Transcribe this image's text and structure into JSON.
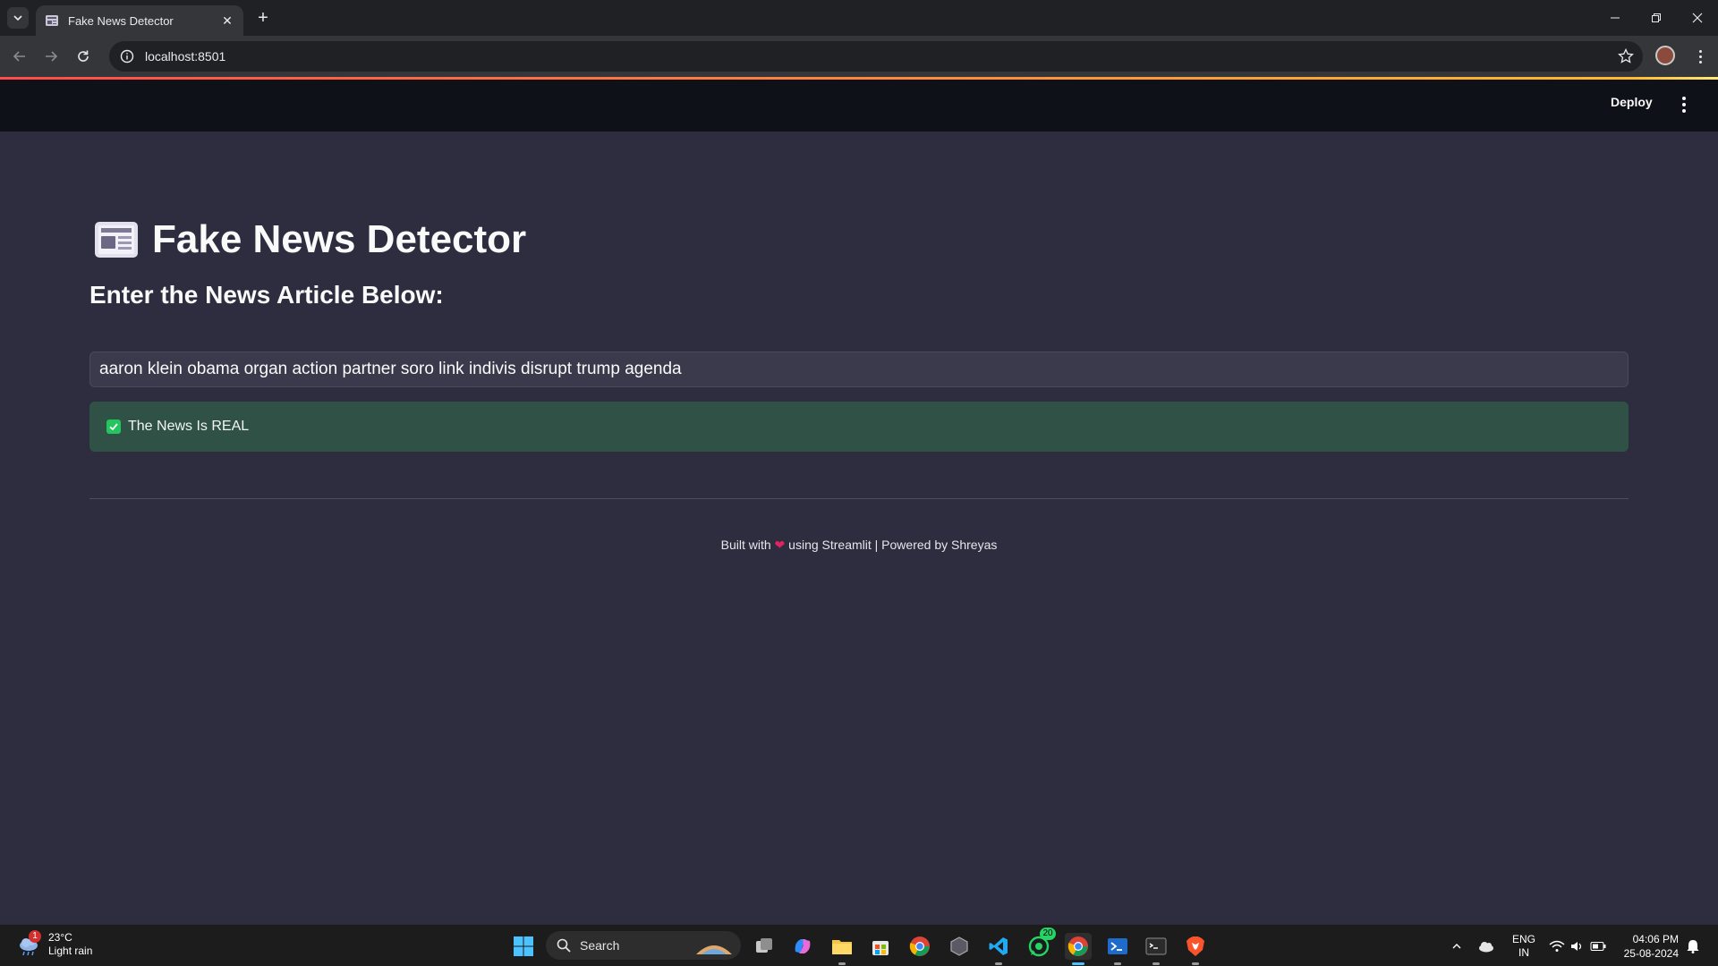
{
  "browser": {
    "tab_title": "Fake News Detector",
    "url": "localhost:8501"
  },
  "streamlit": {
    "deploy_label": "Deploy"
  },
  "app": {
    "title": "Fake News Detector",
    "subheader": "Enter the News Article Below:",
    "input_value": "aaron klein obama organ action partner soro link indivis disrupt trump agenda",
    "result_text": "The News Is REAL",
    "footer_before": "Built with",
    "footer_after": "using Streamlit | Powered by Shreyas"
  },
  "taskbar": {
    "weather_temp": "23°C",
    "weather_desc": "Light rain",
    "weather_badge": "1",
    "search_label": "Search",
    "whatsapp_badge": "20",
    "lang_top": "ENG",
    "lang_bottom": "IN",
    "time": "04:06 PM",
    "date": "25-08-2024"
  },
  "colors": {
    "app_bg": "#2e2d3f",
    "header_bg": "#0e1117",
    "success_bg": "#2f5146",
    "success_icon": "#22c55e"
  }
}
